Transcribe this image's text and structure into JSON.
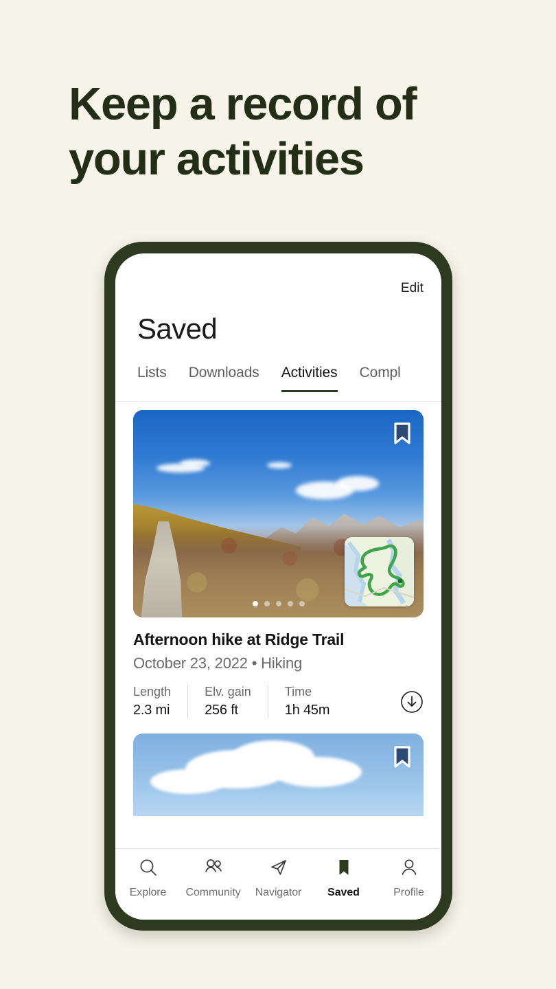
{
  "headline": {
    "line1": "Keep a record of",
    "line2": "your activities",
    "color": "#232d17"
  },
  "background_color": "#f7f4e9",
  "phone": {
    "frame_color": "#2e3a1f",
    "screen": {
      "edit_label": "Edit",
      "title": "Saved",
      "tabs": [
        {
          "label": "Lists",
          "active": false
        },
        {
          "label": "Downloads",
          "active": false
        },
        {
          "label": "Activities",
          "active": true
        },
        {
          "label": "Compl",
          "active": false
        }
      ],
      "cards": [
        {
          "bookmark_icon": "bookmark-filled-icon",
          "map_inset_icon": "route-map-thumbnail",
          "carousel": {
            "count": 5,
            "active_index": 0
          },
          "title": "Afternoon hike at  Ridge Trail",
          "subtitle": "October 23, 2022  •  Hiking",
          "stats": [
            {
              "label": "Length",
              "value": "2.3 mi"
            },
            {
              "label": "Elv. gain",
              "value": "256 ft"
            },
            {
              "label": "Time",
              "value": "1h 45m"
            }
          ],
          "download_icon": "download-circle-icon"
        },
        {
          "bookmark_icon": "bookmark-filled-icon"
        }
      ],
      "bottom_nav": [
        {
          "label": "Explore",
          "icon": "search-icon",
          "active": false
        },
        {
          "label": "Community",
          "icon": "people-icon",
          "active": false
        },
        {
          "label": "Navigator",
          "icon": "paper-plane-icon",
          "active": false
        },
        {
          "label": "Saved",
          "icon": "bookmark-filled-icon",
          "active": true
        },
        {
          "label": "Profile",
          "icon": "person-icon",
          "active": false
        }
      ]
    }
  }
}
